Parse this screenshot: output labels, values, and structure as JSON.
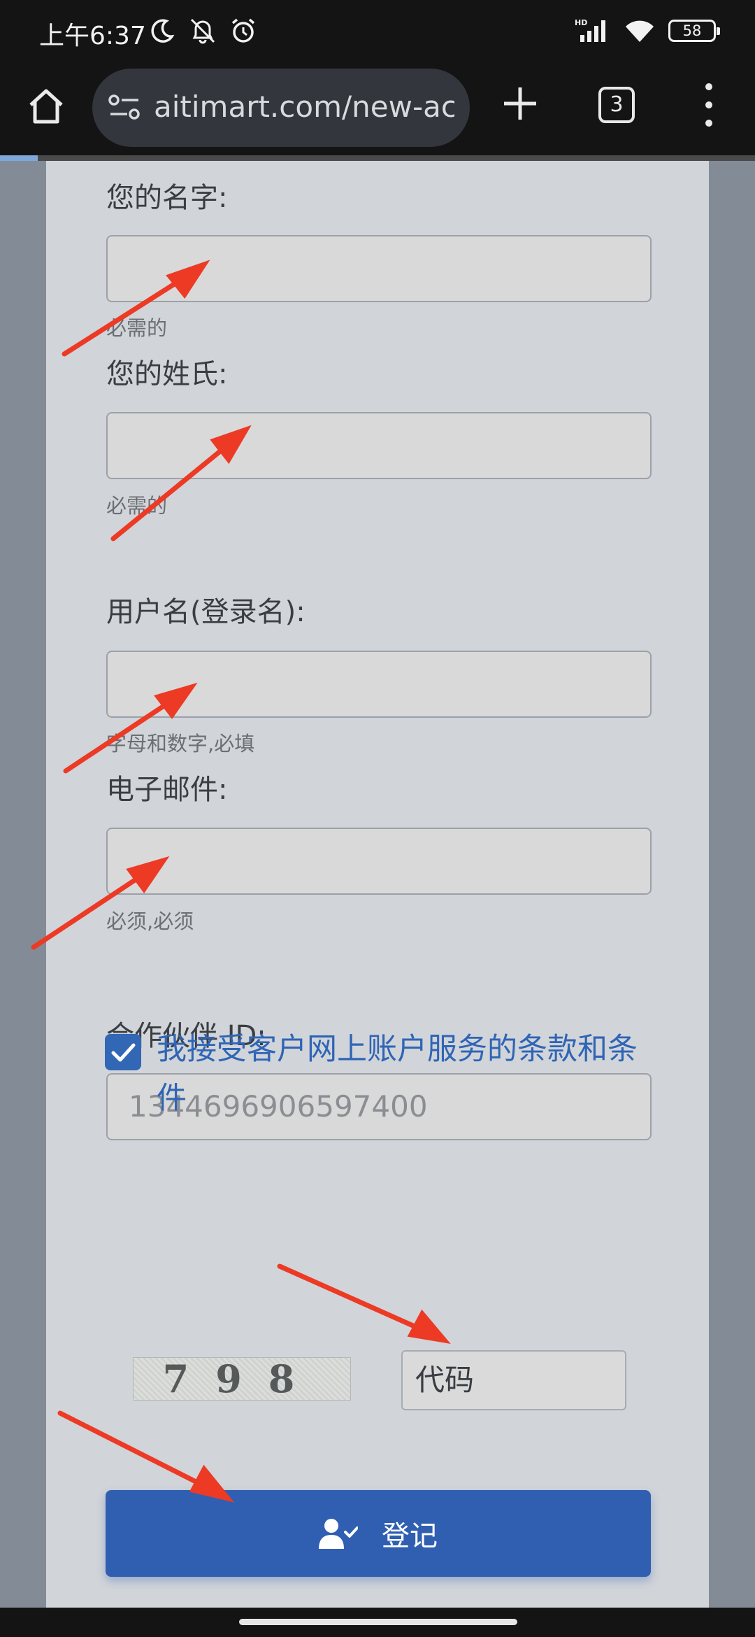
{
  "status_bar": {
    "time": "上午6:37",
    "battery": "58",
    "icons": [
      "moon-icon",
      "mute-icon",
      "alarm-icon",
      "hd-signal-icon",
      "wifi-icon",
      "battery-icon"
    ]
  },
  "browser": {
    "url": "aitimart.com/new-acc",
    "tab_count": "3",
    "load_progress": 0.05
  },
  "form": {
    "first_name": {
      "label": "您的名字:",
      "value": "",
      "help": "必需的"
    },
    "last_name": {
      "label": "您的姓氏:",
      "value": "",
      "help": "必需的"
    },
    "username": {
      "label": "用户名(登录名):",
      "value": "",
      "help": "字母和数字,必填"
    },
    "email": {
      "label": "电子邮件:",
      "value": "",
      "help": "必须,必须"
    },
    "partner_id": {
      "label": "合作伙伴 ID:",
      "value": "1344696906597400"
    },
    "terms": {
      "checked": true,
      "label": "我接受客户网上账户服务的条款和条件"
    },
    "captcha": {
      "image_text": "798",
      "input_value": "代码"
    },
    "submit_label": "登记"
  },
  "colors": {
    "accent": "#305fb1",
    "link": "#2f65b5",
    "annotation_arrow": "#ec3a25",
    "page_background": "#d1d4d9"
  }
}
